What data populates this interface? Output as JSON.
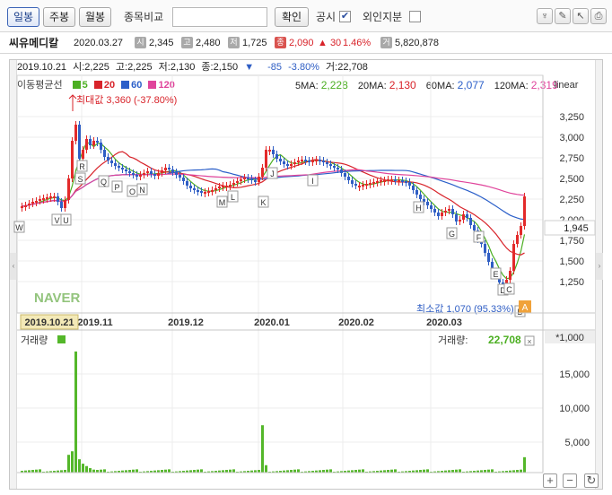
{
  "toolbar": {
    "period_buttons": [
      "일봉",
      "주봉",
      "월봉"
    ],
    "compare_label": "종목비교",
    "confirm_label": "확인",
    "disclosure_label": "공시",
    "foreign_label": "외인지분",
    "disclosure_checked": true,
    "foreign_checked": false
  },
  "info": {
    "name": "씨유메디칼",
    "date": "2020.03.27",
    "open_badge": "시",
    "open": "2,345",
    "high_badge": "고",
    "high": "2,480",
    "low_badge": "저",
    "low": "1,725",
    "close_badge": "종",
    "close": "2,090",
    "change": "▲ 30",
    "change_pct": "1.46%",
    "volume_badge": "거",
    "volume": "5,820,878"
  },
  "status": {
    "date": "2019.10.21",
    "open": "시:2,225",
    "high": "고:2,225",
    "low": "저:2,130",
    "close": "종:2,150",
    "arrow": "▼",
    "change": "-85",
    "pct": "-3.80%",
    "volume": "거:22,708"
  },
  "legend": {
    "label": "이동평균선",
    "items": [
      {
        "label": "5",
        "color": "#4caf22"
      },
      {
        "label": "20",
        "color": "#d8232a"
      },
      {
        "label": "60",
        "color": "#2b5fc9"
      },
      {
        "label": "120",
        "color": "#e0449b"
      }
    ],
    "ma5_label": "5MA:",
    "ma5": "2,228",
    "ma20_label": "20MA:",
    "ma20": "2,130",
    "ma60_label": "60MA:",
    "ma60": "2,077",
    "ma120_label": "120MA:",
    "ma120": "2,319"
  },
  "chart": {
    "scale": "linear",
    "price_ticks": [
      "3,250",
      "3,000",
      "2,750",
      "2,500",
      "2,250",
      "2,000",
      "1,750",
      "1,500",
      "1,250"
    ],
    "current_price": "1,945",
    "max_label": "최대값 3,360 (-37.80%)",
    "min_label": "최소값 1,070 (95.33%)",
    "a_badge": "A",
    "watermark": "NAVER",
    "x_labels": [
      "2019.11",
      "2019.12",
      "2020.01",
      "2020.02",
      "2020.03"
    ],
    "selected_date": "2019.10.21",
    "event_markers": [
      "W",
      "V",
      "U",
      "S",
      "R",
      "Q",
      "P",
      "O",
      "N",
      "M",
      "L",
      "K",
      "J",
      "I",
      "H",
      "G",
      "F",
      "E",
      "D",
      "C",
      "B"
    ],
    "volume_label": "거래량",
    "volume_right_label": "거래량:",
    "volume_value": "22,708",
    "volume_unit": "*1,000",
    "volume_ticks": [
      "15,000",
      "10,000",
      "5,000"
    ],
    "colors": {
      "up": "#e32a2a",
      "down": "#2f5ec4",
      "volume": "#54b72a"
    }
  }
}
